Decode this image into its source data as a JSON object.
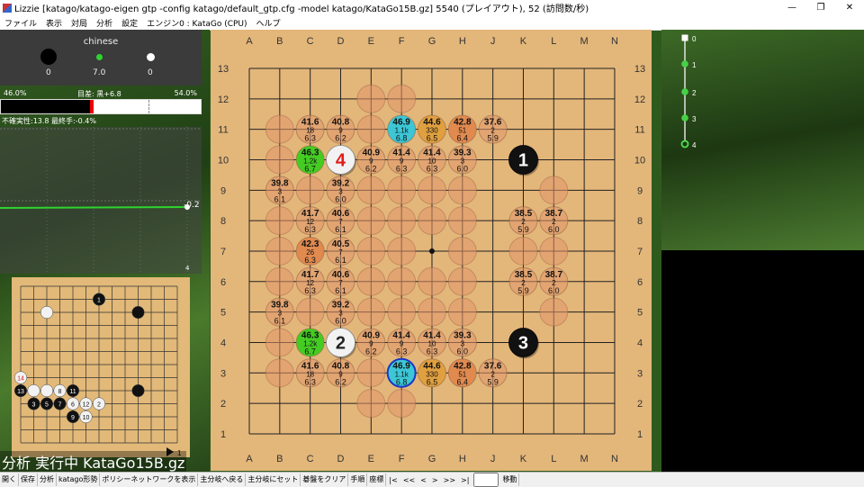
{
  "window": {
    "title": "Lizzie [katago/katago-eigen gtp -config katago/default_gtp.cfg -model katago/KataGo15B.gz] 5540 (プレイアウト), 52 (訪問数/秒)"
  },
  "menu": [
    "ファイル",
    "表示",
    "対局",
    "分析",
    "設定",
    "エンジン0 : KataGo (CPU)",
    "ヘルプ"
  ],
  "player": {
    "rule": "chinese",
    "black_captures": "0",
    "komi": "7.0",
    "white_captures": "0"
  },
  "winrate": {
    "black": "46.0%",
    "lead": "目差: 黒+6.8",
    "white": "54.0%",
    "black_fraction": 0.46
  },
  "uncertainty": "不確実性:13.8 最終手:-0.4%",
  "graph": {
    "value_label": "-0.2",
    "move_label": "4"
  },
  "status_text": "分析 実行中 KataGo15B.gz",
  "board": {
    "columns": [
      "A",
      "B",
      "C",
      "D",
      "E",
      "F",
      "G",
      "H",
      "J",
      "K",
      "L",
      "M",
      "N"
    ],
    "rows": [
      "13",
      "12",
      "11",
      "10",
      "9",
      "8",
      "7",
      "6",
      "5",
      "4",
      "3",
      "2",
      "1"
    ],
    "stones": [
      {
        "col": 10,
        "row": 10,
        "color": "black",
        "label": "1"
      },
      {
        "col": 4,
        "row": 4,
        "color": "white",
        "label": "2"
      },
      {
        "col": 10,
        "row": 4,
        "color": "black",
        "label": "3"
      },
      {
        "col": 4,
        "row": 10,
        "color": "white",
        "label": "4"
      }
    ],
    "stars": [
      [
        4,
        4
      ],
      [
        4,
        10
      ],
      [
        10,
        4
      ],
      [
        10,
        10
      ],
      [
        7,
        7
      ]
    ],
    "candidates": [
      {
        "col": 6,
        "row": 11,
        "wr": "46.9",
        "visits": "1.1k",
        "score": "6.8",
        "color": "#3cc6d6"
      },
      {
        "col": 7,
        "row": 11,
        "wr": "44.6",
        "visits": "330",
        "score": "6.5",
        "color": "#e0a040"
      },
      {
        "col": 8,
        "row": 11,
        "wr": "42.8",
        "visits": "51",
        "score": "6.4",
        "color": "#e08a50"
      },
      {
        "col": 9,
        "row": 11,
        "wr": "37.6",
        "visits": "2",
        "score": "5.9",
        "color": ""
      },
      {
        "col": 3,
        "row": 11,
        "wr": "41.6",
        "visits": "18",
        "score": "6.3",
        "color": ""
      },
      {
        "col": 4,
        "row": 11,
        "wr": "40.8",
        "visits": "9",
        "score": "6.2",
        "color": ""
      },
      {
        "col": 3,
        "row": 10,
        "wr": "46.3",
        "visits": "1.2k",
        "score": "6.7",
        "color": "#44cc22"
      },
      {
        "col": 5,
        "row": 10,
        "wr": "40.9",
        "visits": "9",
        "score": "6.2",
        "color": ""
      },
      {
        "col": 6,
        "row": 10,
        "wr": "41.4",
        "visits": "9",
        "score": "6.3",
        "color": ""
      },
      {
        "col": 7,
        "row": 10,
        "wr": "41.4",
        "visits": "10",
        "score": "6.3",
        "color": ""
      },
      {
        "col": 8,
        "row": 10,
        "wr": "39.3",
        "visits": "3",
        "score": "6.0",
        "color": ""
      },
      {
        "col": 2,
        "row": 9,
        "wr": "39.8",
        "visits": "3",
        "score": "6.1",
        "color": ""
      },
      {
        "col": 4,
        "row": 9,
        "wr": "39.2",
        "visits": "3",
        "score": "6.0",
        "color": ""
      },
      {
        "col": 3,
        "row": 8,
        "wr": "41.7",
        "visits": "12",
        "score": "6.3",
        "color": ""
      },
      {
        "col": 4,
        "row": 8,
        "wr": "40.6",
        "visits": "7",
        "score": "6.1",
        "color": ""
      },
      {
        "col": 3,
        "row": 7,
        "wr": "42.3",
        "visits": "26",
        "score": "6.3",
        "color": "#e08a50"
      },
      {
        "col": 4,
        "row": 7,
        "wr": "40.5",
        "visits": "7",
        "score": "6.1",
        "color": ""
      },
      {
        "col": 3,
        "row": 6,
        "wr": "41.7",
        "visits": "12",
        "score": "6.3",
        "color": ""
      },
      {
        "col": 4,
        "row": 6,
        "wr": "40.6",
        "visits": "7",
        "score": "6.1",
        "color": ""
      },
      {
        "col": 2,
        "row": 5,
        "wr": "39.8",
        "visits": "3",
        "score": "6.1",
        "color": ""
      },
      {
        "col": 4,
        "row": 5,
        "wr": "39.2",
        "visits": "3",
        "score": "6.0",
        "color": ""
      },
      {
        "col": 3,
        "row": 4,
        "wr": "46.3",
        "visits": "1.2k",
        "score": "6.7",
        "color": "#44cc22"
      },
      {
        "col": 5,
        "row": 4,
        "wr": "40.9",
        "visits": "9",
        "score": "6.2",
        "color": ""
      },
      {
        "col": 6,
        "row": 4,
        "wr": "41.4",
        "visits": "9",
        "score": "6.3",
        "color": ""
      },
      {
        "col": 7,
        "row": 4,
        "wr": "41.4",
        "visits": "10",
        "score": "6.3",
        "color": ""
      },
      {
        "col": 8,
        "row": 4,
        "wr": "39.3",
        "visits": "3",
        "score": "6.0",
        "color": ""
      },
      {
        "col": 3,
        "row": 3,
        "wr": "41.6",
        "visits": "18",
        "score": "6.3",
        "color": ""
      },
      {
        "col": 4,
        "row": 3,
        "wr": "40.8",
        "visits": "9",
        "score": "6.2",
        "color": ""
      },
      {
        "col": 6,
        "row": 3,
        "wr": "46.9",
        "visits": "1.1k",
        "score": "6.8",
        "color": "#3cc6d6"
      },
      {
        "col": 7,
        "row": 3,
        "wr": "44.6",
        "visits": "330",
        "score": "6.5",
        "color": "#e0a040"
      },
      {
        "col": 8,
        "row": 3,
        "wr": "42.8",
        "visits": "51",
        "score": "6.4",
        "color": "#e08a50"
      },
      {
        "col": 9,
        "row": 3,
        "wr": "37.6",
        "visits": "2",
        "score": "5.9",
        "color": ""
      },
      {
        "col": 10,
        "row": 8,
        "wr": "38.5",
        "visits": "2",
        "score": "5.9",
        "color": ""
      },
      {
        "col": 11,
        "row": 8,
        "wr": "38.7",
        "visits": "2",
        "score": "6.0",
        "color": ""
      },
      {
        "col": 10,
        "row": 6,
        "wr": "38.5",
        "visits": "2",
        "score": "5.9",
        "color": ""
      },
      {
        "col": 11,
        "row": 6,
        "wr": "38.7",
        "visits": "2",
        "score": "6.0",
        "color": ""
      }
    ],
    "empty_candidates": [
      [
        5,
        12
      ],
      [
        6,
        12
      ],
      [
        2,
        11
      ],
      [
        5,
        11
      ],
      [
        2,
        10
      ],
      [
        3,
        9
      ],
      [
        5,
        9
      ],
      [
        6,
        9
      ],
      [
        7,
        9
      ],
      [
        8,
        9
      ],
      [
        11,
        9
      ],
      [
        2,
        8
      ],
      [
        5,
        8
      ],
      [
        6,
        8
      ],
      [
        7,
        8
      ],
      [
        8,
        8
      ],
      [
        2,
        7
      ],
      [
        5,
        7
      ],
      [
        6,
        7
      ],
      [
        8,
        7
      ],
      [
        10,
        7
      ],
      [
        11,
        7
      ],
      [
        2,
        6
      ],
      [
        5,
        6
      ],
      [
        6,
        6
      ],
      [
        7,
        6
      ],
      [
        8,
        6
      ],
      [
        3,
        5
      ],
      [
        5,
        5
      ],
      [
        6,
        5
      ],
      [
        7,
        5
      ],
      [
        8,
        5
      ],
      [
        11,
        5
      ],
      [
        2,
        4
      ],
      [
        2,
        3
      ],
      [
        5,
        3
      ],
      [
        5,
        2
      ],
      [
        6,
        2
      ]
    ]
  },
  "mini_board": {
    "size": 13,
    "stones": [
      {
        "col": 7,
        "row": 2,
        "color": "black",
        "label": "1"
      },
      {
        "col": 3,
        "row": 3,
        "color": "white",
        "label": ""
      },
      {
        "col": 10,
        "row": 3,
        "color": "black",
        "label": ""
      },
      {
        "col": 10,
        "row": 9,
        "color": "black",
        "label": ""
      },
      {
        "col": 2,
        "row": 9,
        "color": "white",
        "label": ""
      },
      {
        "col": 3,
        "row": 9,
        "color": "white",
        "label": ""
      },
      {
        "col": 4,
        "row": 9,
        "color": "white",
        "label": "8"
      },
      {
        "col": 5,
        "row": 9,
        "color": "black",
        "label": "11"
      },
      {
        "col": 1,
        "row": 9,
        "color": "black",
        "label": "13"
      },
      {
        "col": 1,
        "row": 8,
        "color": "white",
        "label": "14"
      },
      {
        "col": 2,
        "row": 10,
        "color": "black",
        "label": "3"
      },
      {
        "col": 3,
        "row": 10,
        "color": "black",
        "label": "5"
      },
      {
        "col": 4,
        "row": 10,
        "color": "black",
        "label": "7"
      },
      {
        "col": 5,
        "row": 10,
        "color": "white",
        "label": "6"
      },
      {
        "col": 6,
        "row": 10,
        "color": "white",
        "label": "12"
      },
      {
        "col": 7,
        "row": 10,
        "color": "white",
        "label": "2"
      },
      {
        "col": 5,
        "row": 11,
        "color": "black",
        "label": "9"
      },
      {
        "col": 6,
        "row": 11,
        "color": "white",
        "label": "10"
      }
    ],
    "footer": "1"
  },
  "tree": {
    "labels": [
      "0",
      "1",
      "2",
      "3",
      "4"
    ]
  },
  "toolbar": {
    "buttons": [
      "開く",
      "保存",
      "分析",
      "katago形勢",
      "ポリシーネットワークを表示",
      "主分岐へ戻る",
      "主分岐にセット",
      "碁盤をクリア",
      "手順",
      "座標"
    ],
    "nav": [
      "|<",
      "<<",
      "<",
      ">",
      ">>",
      ">|"
    ],
    "goto": "移動"
  }
}
